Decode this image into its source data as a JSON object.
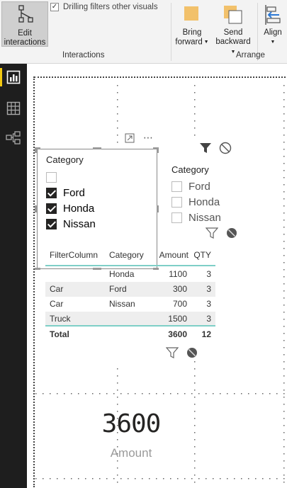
{
  "ribbon": {
    "edit_interactions": {
      "line1": "Edit",
      "line2": "interactions"
    },
    "drilling_checkbox": {
      "label": "Drilling filters other visuals",
      "checked": true
    },
    "interactions_group_title": "Interactions",
    "bring_forward": {
      "line1": "Bring",
      "line2": "forward"
    },
    "send_backward": {
      "line1": "Send",
      "line2": "backward"
    },
    "align": {
      "line1": "Align"
    },
    "arrange_group_title": "Arrange"
  },
  "sidebar": {
    "items": [
      {
        "icon": "report-view-icon",
        "active": true
      },
      {
        "icon": "data-view-icon",
        "active": false
      },
      {
        "icon": "model-view-icon",
        "active": false
      }
    ]
  },
  "slicer_left": {
    "title": "Category",
    "items": [
      {
        "label": "",
        "checked": false
      },
      {
        "label": "Ford",
        "checked": true
      },
      {
        "label": "Honda",
        "checked": true
      },
      {
        "label": "Nissan",
        "checked": true
      }
    ]
  },
  "slicer_right": {
    "title": "Category",
    "items": [
      {
        "label": "Ford",
        "checked": false
      },
      {
        "label": "Honda",
        "checked": false
      },
      {
        "label": "Nissan",
        "checked": false
      }
    ]
  },
  "table": {
    "columns": [
      "FilterColumn",
      "Category",
      "Amount",
      "QTY"
    ],
    "rows": [
      [
        "",
        "Honda",
        "1100",
        "3"
      ],
      [
        "Car",
        "Ford",
        "300",
        "3"
      ],
      [
        "Car",
        "Nissan",
        "700",
        "3"
      ],
      [
        "Truck",
        "",
        "1500",
        "3"
      ]
    ],
    "total": [
      "Total",
      "",
      "3600",
      "12"
    ]
  },
  "card": {
    "value": "3600",
    "label": "Amount"
  },
  "colors": {
    "ribbon_bg": "#f3f3f3",
    "sidebar_bg": "#1e1e1e",
    "sidebar_active": "#f2c811",
    "table_accent": "#7ecfc7",
    "icon_yellow": "#f2c16b"
  }
}
